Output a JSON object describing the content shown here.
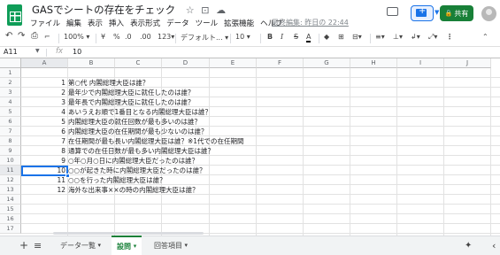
{
  "header": {
    "title": "GASでシートの存在をチェック",
    "star_icon": "☆",
    "move_icon": "⊡",
    "cloud_icon": "☁",
    "menu": [
      "ファイル",
      "編集",
      "表示",
      "挿入",
      "表示形式",
      "データ",
      "ツール",
      "拡張機能",
      "ヘルプ"
    ],
    "last_edit": "最終編集: 昨日の 22:44",
    "share_label": "共有",
    "share_lock": "🔒"
  },
  "toolbar": {
    "undo": "↶",
    "redo": "↷",
    "print": "⎙",
    "paint": "⌐",
    "zoom": "100%",
    "currency": "¥",
    "percent": "%",
    "dec_less": ".0",
    "dec_more": ".00",
    "more_formats": "123",
    "font": "デフォルト...",
    "font_size": "10",
    "bold": "B",
    "italic": "I",
    "strike": "S",
    "text_color": "A",
    "more": "⋮",
    "collapse": "⌃"
  },
  "formula_bar": {
    "cell_ref": "A11",
    "fx": "fx",
    "value": "10"
  },
  "grid": {
    "columns": [
      "A",
      "B",
      "C",
      "D",
      "E",
      "F",
      "G",
      "H",
      "I",
      "J"
    ],
    "rows": [
      "1",
      "2",
      "3",
      "4",
      "5",
      "6",
      "7",
      "8",
      "9",
      "10",
      "11",
      "12",
      "13",
      "14",
      "15",
      "16",
      "17"
    ],
    "data": [
      {
        "n": "1",
        "q": "第○代 内閣総理大臣は誰？"
      },
      {
        "n": "2",
        "q": "最年少で内閣総理大臣に就任したのは誰？"
      },
      {
        "n": "3",
        "q": "最年長で内閣総理大臣に就任したのは誰？"
      },
      {
        "n": "4",
        "q": "あいうえお順で1番目となる内閣総理大臣は誰？"
      },
      {
        "n": "5",
        "q": "内閣総理大臣の就任回数が最も多いのは誰？"
      },
      {
        "n": "6",
        "q": "内閣総理大臣の在任期間が最も少ないのは誰？"
      },
      {
        "n": "7",
        "q": "在任期間が最も長い内閣総理大臣は誰？※1代での在任期間"
      },
      {
        "n": "8",
        "q": "通算での在任日数が最も多い内閣総理大臣は誰？"
      },
      {
        "n": "9",
        "q": "○年○月○日に内閣総理大臣だったのは誰？"
      },
      {
        "n": "10",
        "q": "○○が起きた時に内閣総理大臣だったのは誰？"
      },
      {
        "n": "11",
        "q": "○○を行った内閣総理大臣は誰？"
      },
      {
        "n": "12",
        "q": "海外な出来事××の時の内閣総理大臣は誰？"
      }
    ]
  },
  "bottom": {
    "add": "+",
    "all_sheets": "≡",
    "tabs": [
      "データ一覧",
      "設問",
      "回答項目"
    ],
    "tab_arrow": "▾",
    "explore_icon": "✦",
    "side_arrow": "‹"
  }
}
